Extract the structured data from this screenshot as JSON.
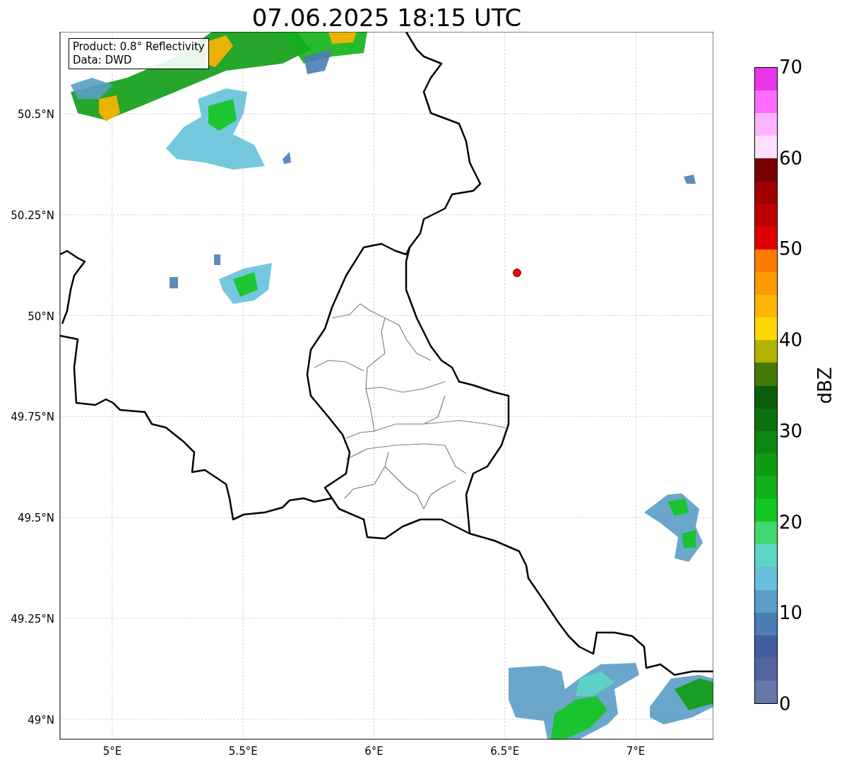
{
  "title": "07.06.2025 18:15 UTC",
  "info_box": [
    "Product: 0.8° Reflectivity",
    "Data: DWD"
  ],
  "map": {
    "lat_ticks": [
      "50.5°N",
      "50.25°N",
      "50°N",
      "49.75°N",
      "49.5°N",
      "49.25°N",
      "49°N"
    ],
    "lon_ticks": [
      "5°E",
      "5.5°E",
      "6°E",
      "6.5°E",
      "7°E"
    ],
    "radar_site": {
      "color": "#ff0000"
    }
  },
  "colorbar": {
    "label": "dBZ",
    "ticks": [
      "70",
      "60",
      "50",
      "40",
      "30",
      "20",
      "10",
      "0"
    ],
    "segments": [
      {
        "color": "#e936e9"
      },
      {
        "color": "#ff6cff"
      },
      {
        "color": "#ffb3ff"
      },
      {
        "color": "#ffdfff"
      },
      {
        "color": "#780000"
      },
      {
        "color": "#a00000"
      },
      {
        "color": "#c00000"
      },
      {
        "color": "#e00000"
      },
      {
        "color": "#ff7b00"
      },
      {
        "color": "#ff9900"
      },
      {
        "color": "#ffb400"
      },
      {
        "color": "#ffd700"
      },
      {
        "color": "#b1b202"
      },
      {
        "color": "#457a08"
      },
      {
        "color": "#0a5e0a"
      },
      {
        "color": "#0b720f"
      },
      {
        "color": "#0d8712"
      },
      {
        "color": "#0f9c15"
      },
      {
        "color": "#11b11b"
      },
      {
        "color": "#13c61e"
      },
      {
        "color": "#3ed86e"
      },
      {
        "color": "#5cd6c4"
      },
      {
        "color": "#65c2da"
      },
      {
        "color": "#5a9dc5"
      },
      {
        "color": "#4d7db5"
      },
      {
        "color": "#425ea2"
      },
      {
        "color": "#5065a0"
      },
      {
        "color": "#6576a8"
      }
    ]
  }
}
